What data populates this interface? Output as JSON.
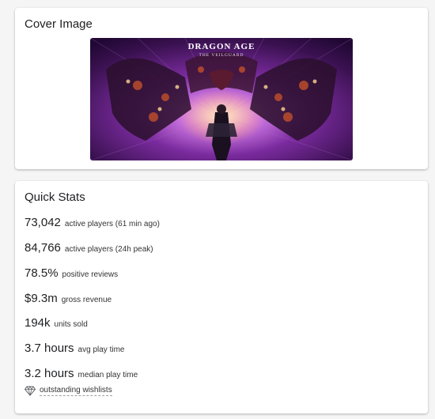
{
  "cover": {
    "title": "Cover Image",
    "logo_line1": "DRAGON AGE",
    "logo_line2": "THE VEILGUARD"
  },
  "stats": {
    "title": "Quick Stats",
    "items": [
      {
        "value": "73,042",
        "label": "active players (61 min ago)"
      },
      {
        "value": "84,766",
        "label": "active players (24h peak)"
      },
      {
        "value": "78.5%",
        "label": "positive reviews"
      },
      {
        "value": "$9.3m",
        "label": "gross revenue"
      },
      {
        "value": "194k",
        "label": "units sold"
      },
      {
        "value": "3.7 hours",
        "label": "avg play time"
      },
      {
        "value": "3.2 hours",
        "label": "median play time"
      }
    ],
    "wishlist_label": "outstanding wishlists",
    "wishlist_icon": "diamond-icon"
  }
}
